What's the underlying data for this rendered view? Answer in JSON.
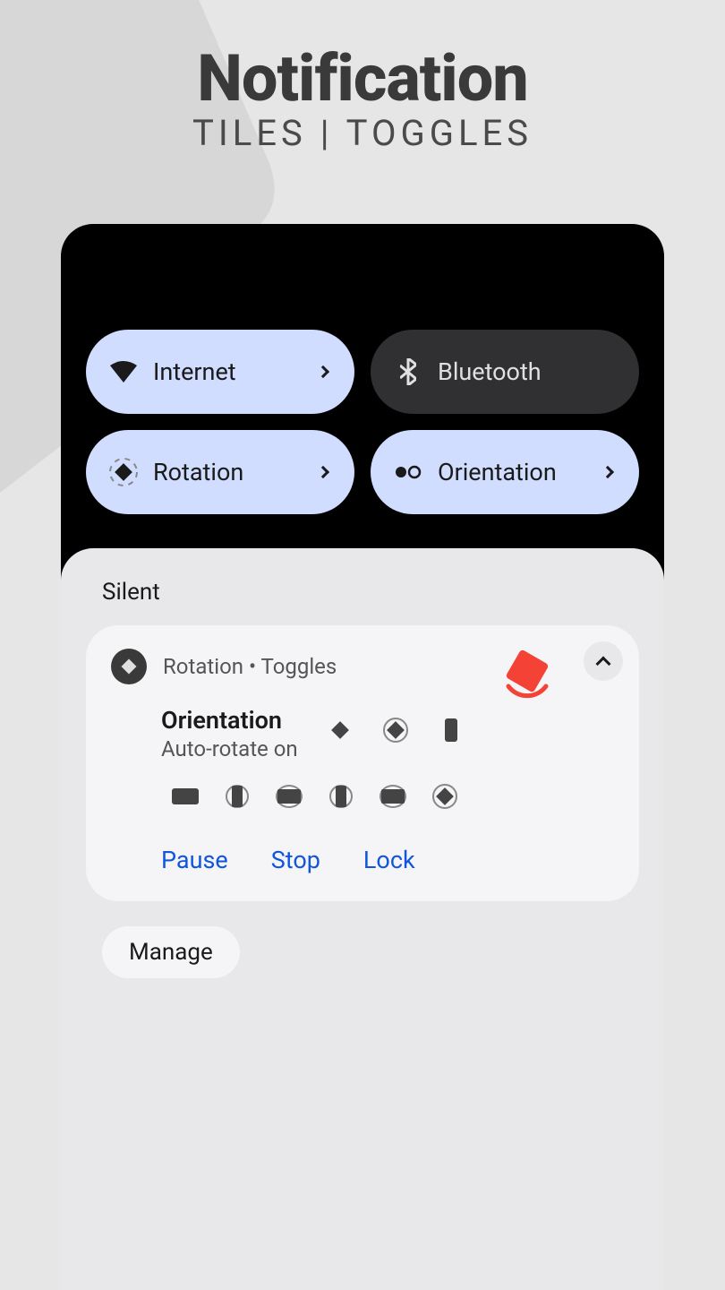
{
  "header": {
    "title": "Notification",
    "subtitle": "TILES | TOGGLES"
  },
  "tiles": [
    {
      "label": "Internet",
      "active": true,
      "hasChevron": true,
      "icon": "wifi"
    },
    {
      "label": "Bluetooth",
      "active": false,
      "hasChevron": false,
      "icon": "bluetooth"
    },
    {
      "label": "Rotation",
      "active": true,
      "hasChevron": true,
      "icon": "rotation"
    },
    {
      "label": "Orientation",
      "active": true,
      "hasChevron": true,
      "icon": "orientation"
    }
  ],
  "notifications": {
    "sectionLabel": "Silent",
    "card": {
      "appName": "Rotation • Toggles",
      "title": "Orientation",
      "subtitle": "Auto-rotate on",
      "actions": [
        "Pause",
        "Stop",
        "Lock"
      ]
    },
    "manageLabel": "Manage"
  }
}
